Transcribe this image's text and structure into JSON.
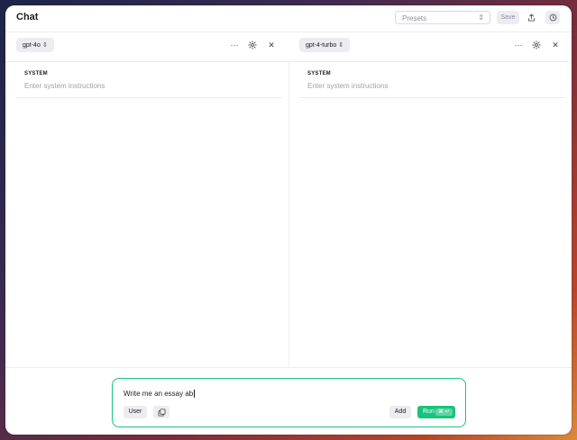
{
  "header": {
    "title": "Chat",
    "presets_placeholder": "Presets",
    "save_label": "Save"
  },
  "panels": [
    {
      "model": "gpt-4o",
      "system_label": "SYSTEM",
      "system_placeholder": "Enter system instructions"
    },
    {
      "model": "gpt-4-turbo",
      "system_label": "SYSTEM",
      "system_placeholder": "Enter system instructions"
    }
  ],
  "composer": {
    "input_value": "Write me an essay ab",
    "role_label": "User",
    "add_label": "Add",
    "run_label": "Run",
    "run_shortcut": "⌘ ↵"
  },
  "colors": {
    "accent": "#19c37d",
    "button_bg": "#ececf1"
  }
}
